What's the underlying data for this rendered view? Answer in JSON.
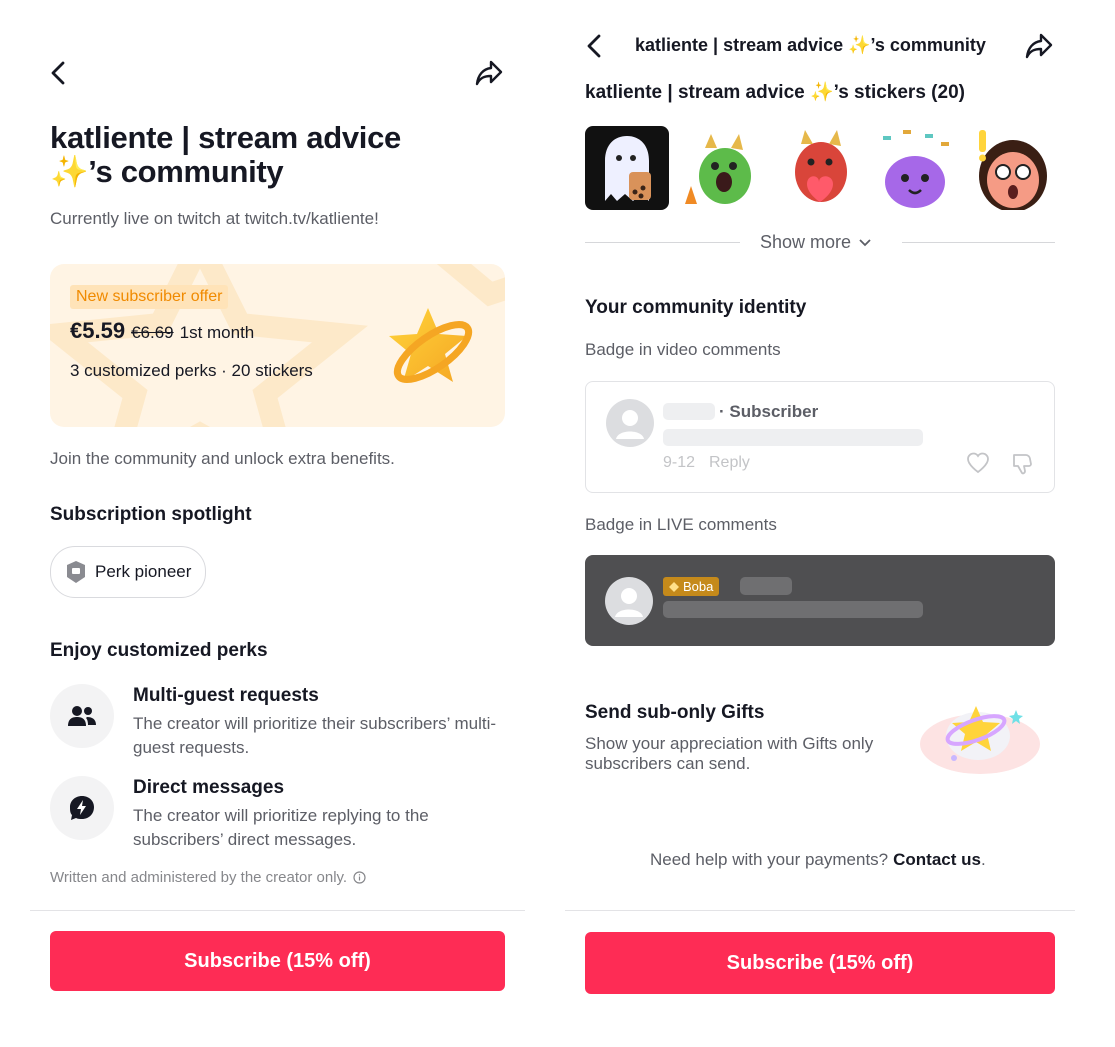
{
  "colors": {
    "accent": "#fe2c55",
    "offer_bg": "#fff4e4",
    "offer_tag": "#f08a00",
    "badge_boba": "#c58a1b",
    "live_card": "#4f4f51"
  },
  "left": {
    "title": "katliente | stream advice ✨’s community",
    "description": "Currently live on twitch at twitch.tv/katliente!",
    "offer": {
      "tag": "New subscriber offer",
      "price": "€5.59",
      "old_price": "€6.69",
      "period": "1st month",
      "perks_summary": "3 customized perks · 20 stickers"
    },
    "join_text": "Join the community and unlock extra benefits.",
    "spotlight_heading": "Subscription spotlight",
    "spotlight_chip": "Perk pioneer",
    "perks_heading": "Enjoy customized perks",
    "perks": [
      {
        "title": "Multi-guest requests",
        "desc": "The creator will prioritize their subscribers’ multi-guest requests.",
        "icon": "people-icon"
      },
      {
        "title": "Direct messages",
        "desc": "The creator will prioritize replying to the subscribers’ direct messages.",
        "icon": "message-bolt-icon"
      }
    ],
    "footnote": "Written and administered by the creator only.",
    "subscribe_label": "Subscribe (15% off)"
  },
  "right": {
    "header_title": "katliente | stream advice ✨’s community",
    "stickers_heading": "katliente | stream advice ✨’s stickers (20)",
    "stickers": [
      "ghost-boba-sticker",
      "green-dragon-sticker",
      "red-dragon-heart-sticker",
      "purple-octopus-sticker",
      "surprised-face-sticker"
    ],
    "show_more": "Show more",
    "identity_heading": "Your community identity",
    "badge_video_label": "Badge in video comments",
    "comment_subscriber": "· Subscriber",
    "comment_date": "9-12",
    "comment_reply": "Reply",
    "badge_live_label": "Badge in LIVE comments",
    "boba_label": "Boba",
    "gifts_heading": "Send sub-only Gifts",
    "gifts_desc": "Show your appreciation with Gifts only subscribers can send.",
    "help_text": "Need help with your payments?",
    "contact_link": "Contact us",
    "help_period": ".",
    "subscribe_label": "Subscribe (15% off)"
  }
}
